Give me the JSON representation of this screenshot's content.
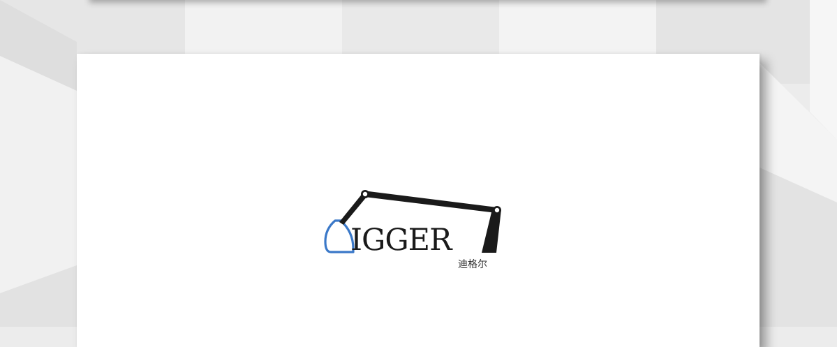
{
  "logo": {
    "wordmark": "IGGER",
    "tagline": "迪格尔",
    "brand_color": "#3a78c8",
    "ink_color": "#1a1a1a",
    "icon": "excavator-arm-icon"
  },
  "colors": {
    "background": "#ececec",
    "card": "#ffffff"
  }
}
